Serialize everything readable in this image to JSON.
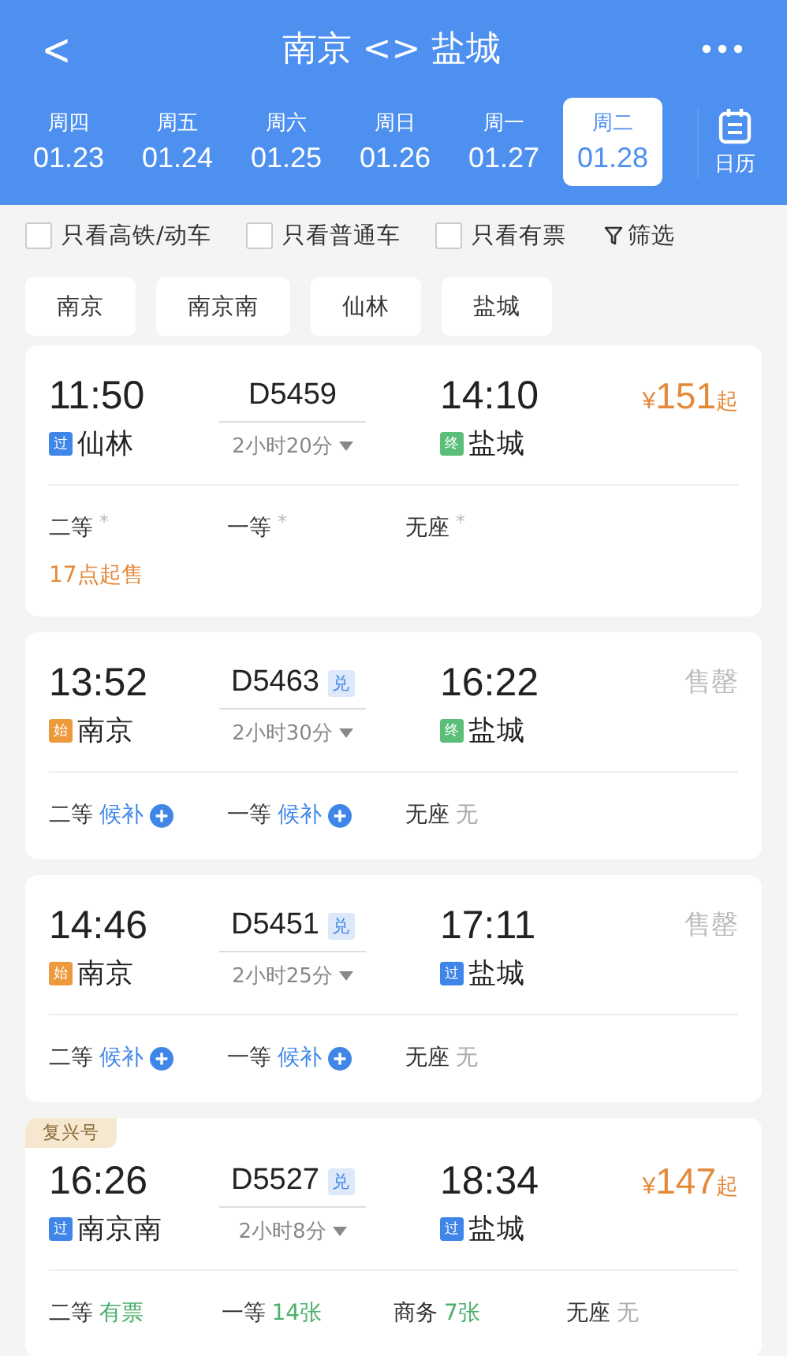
{
  "title": "南京 <> 盐城",
  "back": "<",
  "dates": [
    {
      "weekday": "周四",
      "date": "01.23",
      "selected": false
    },
    {
      "weekday": "周五",
      "date": "01.24",
      "selected": false
    },
    {
      "weekday": "周六",
      "date": "01.25",
      "selected": false
    },
    {
      "weekday": "周日",
      "date": "01.26",
      "selected": false
    },
    {
      "weekday": "周一",
      "date": "01.27",
      "selected": false
    },
    {
      "weekday": "周二",
      "date": "01.28",
      "selected": true
    }
  ],
  "calendar_label": "日历",
  "filters": [
    {
      "label": "只看高铁/动车",
      "checked": false
    },
    {
      "label": "只看普通车",
      "checked": false
    },
    {
      "label": "只看有票",
      "checked": false
    }
  ],
  "filter_button": "筛选",
  "stations": [
    "南京",
    "南京南",
    "仙林",
    "盐城"
  ],
  "trains": [
    {
      "depart": "11:50",
      "train_no": "D5459",
      "arrive": "14:10",
      "from_tag": {
        "kind": "pass",
        "label": "过"
      },
      "from": "仙林",
      "to_tag": {
        "kind": "end",
        "label": "终"
      },
      "to": "盐城",
      "duration": "2小时20分",
      "price": {
        "kind": "price",
        "currency": "¥",
        "amount": "151",
        "suffix": "起"
      },
      "seats": [
        {
          "class": "二等",
          "kind": "star",
          "status": "*"
        },
        {
          "class": "一等",
          "kind": "star",
          "status": "*"
        },
        {
          "class": "无座",
          "kind": "star",
          "status": "*"
        }
      ],
      "note": "17点起售"
    },
    {
      "depart": "13:52",
      "train_no": "D5463",
      "badge": "兑",
      "arrive": "16:22",
      "from_tag": {
        "kind": "start",
        "label": "始"
      },
      "from": "南京",
      "to_tag": {
        "kind": "end",
        "label": "终"
      },
      "to": "盐城",
      "duration": "2小时30分",
      "price": {
        "kind": "soldout",
        "text": "售罄"
      },
      "seats": [
        {
          "class": "二等",
          "kind": "waitlist",
          "status": "候补"
        },
        {
          "class": "一等",
          "kind": "waitlist",
          "status": "候补"
        },
        {
          "class": "无座",
          "kind": "none",
          "status": "无"
        }
      ]
    },
    {
      "depart": "14:46",
      "train_no": "D5451",
      "badge": "兑",
      "arrive": "17:11",
      "from_tag": {
        "kind": "start",
        "label": "始"
      },
      "from": "南京",
      "to_tag": {
        "kind": "pass",
        "label": "过"
      },
      "to": "盐城",
      "duration": "2小时25分",
      "price": {
        "kind": "soldout",
        "text": "售罄"
      },
      "seats": [
        {
          "class": "二等",
          "kind": "waitlist",
          "status": "候补"
        },
        {
          "class": "一等",
          "kind": "waitlist",
          "status": "候补"
        },
        {
          "class": "无座",
          "kind": "none",
          "status": "无"
        }
      ]
    },
    {
      "ribbon": "复兴号",
      "depart": "16:26",
      "train_no": "D5527",
      "badge": "兑",
      "arrive": "18:34",
      "from_tag": {
        "kind": "pass",
        "label": "过"
      },
      "from": "南京南",
      "to_tag": {
        "kind": "pass",
        "label": "过"
      },
      "to": "盐城",
      "duration": "2小时8分",
      "price": {
        "kind": "price",
        "currency": "¥",
        "amount": "147",
        "suffix": "起"
      },
      "seats": [
        {
          "class": "二等",
          "kind": "available",
          "status": "有票"
        },
        {
          "class": "一等",
          "kind": "available",
          "status": "14张"
        },
        {
          "class": "商务",
          "kind": "available",
          "status": "7张"
        },
        {
          "class": "无座",
          "kind": "none",
          "status": "无"
        }
      ]
    }
  ]
}
